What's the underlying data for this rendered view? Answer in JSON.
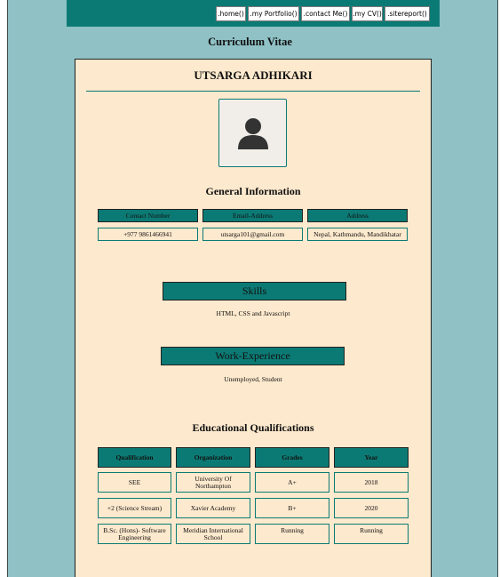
{
  "nav": {
    "items": [
      ".home()",
      ".my Portfolio()",
      ".contact Me()",
      ".my CV()",
      ".sitereport()"
    ]
  },
  "page_title": "Curriculum Vitae",
  "profile": {
    "name": "UTSARGA ADHIKARI",
    "avatar_icon": "user-avatar-icon"
  },
  "general": {
    "heading": "General Information",
    "headers": [
      "Contact Number",
      "Email-Address",
      "Address"
    ],
    "values": [
      "+977 9861466941",
      "utsarga101@gmail.com",
      "Nepal, Kathmandu, Mandikhatar"
    ]
  },
  "skills": {
    "heading": "Skills",
    "text": "HTML, CSS and Javascript"
  },
  "work": {
    "heading": "Work-Experience",
    "text": "Unemployed, Student"
  },
  "education": {
    "heading": "Educational Qualifications",
    "headers": [
      "Qualification",
      "Organization",
      "Grades",
      "Year"
    ],
    "rows": [
      [
        "SEE",
        "University Of Northampton",
        "A+",
        "2018"
      ],
      [
        "+2 (Science Stream)",
        "Xavier Academy",
        "B+",
        "2020"
      ],
      [
        "B.Sc. (Hons)- Software Engineering",
        "Meridian International School",
        "Running",
        "Running"
      ]
    ]
  },
  "colors": {
    "teal": "#0c7a74",
    "page_background": "#8fc1c5",
    "card_background": "#fde9cd"
  }
}
